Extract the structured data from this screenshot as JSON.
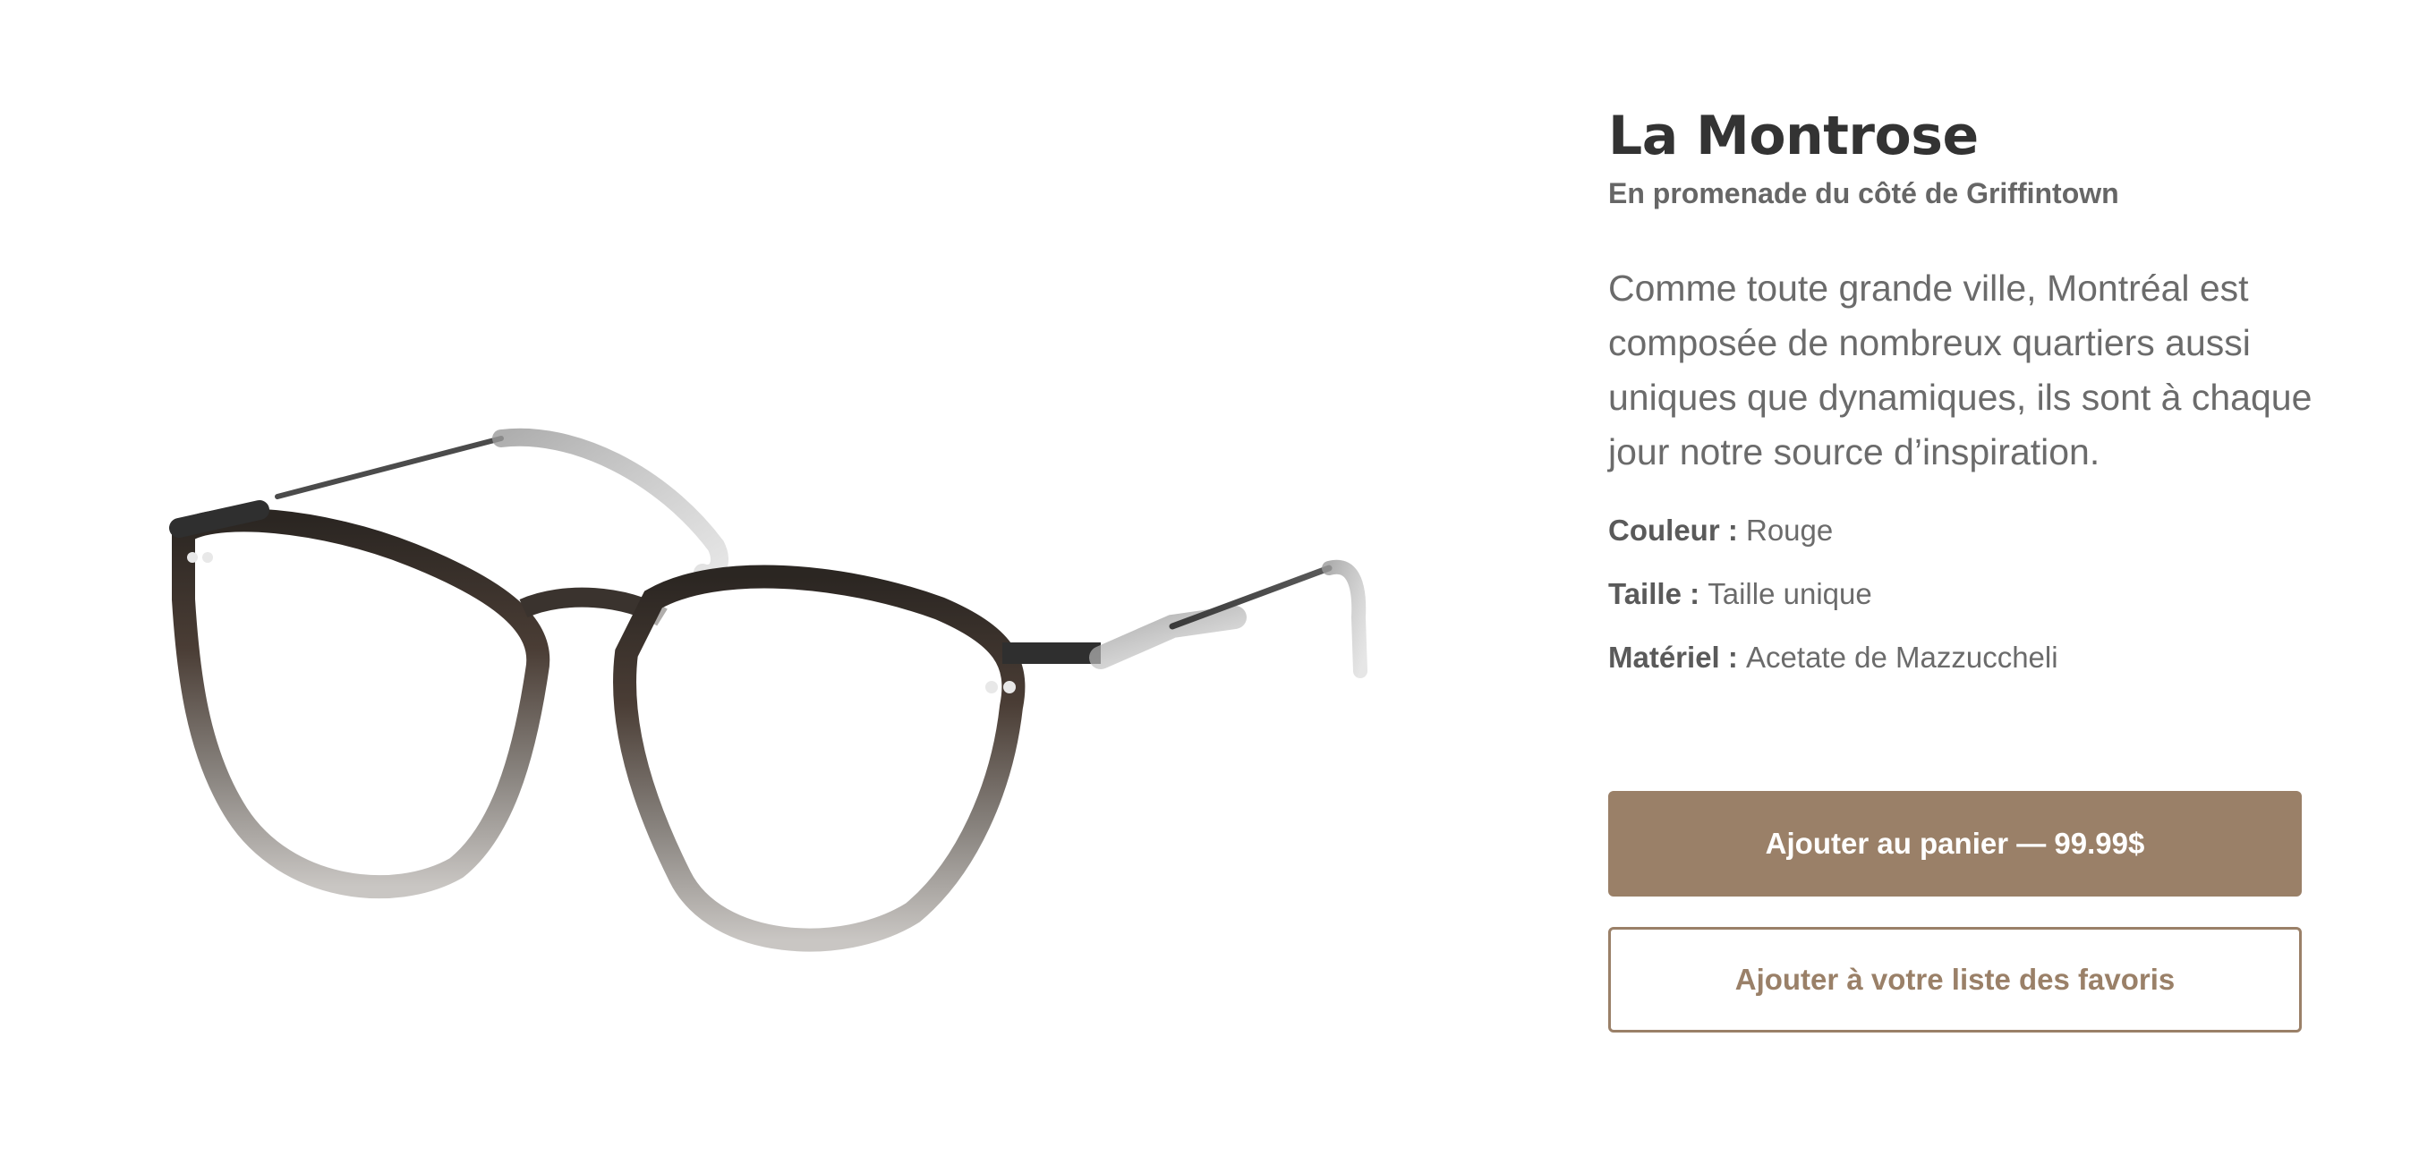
{
  "product": {
    "title": "La Montrose",
    "subtitle": "En promenade du côté de Griffintown",
    "description": "Comme toute grande ville, Montréal est composée de nombreux quartiers aussi uniques que dynamiques, ils sont à chaque jour notre source d’inspiration.",
    "image_alt": "glasses-product-image"
  },
  "specs": [
    {
      "label": "Couleur",
      "sep": " : ",
      "value": "Rouge"
    },
    {
      "label": "Taille",
      "sep": " : ",
      "value": "Taille unique"
    },
    {
      "label": "Matériel",
      "sep": " : ",
      "value": "Acetate de Mazzuccheli"
    }
  ],
  "actions": {
    "add_to_cart": "Ajouter au panier — 99.99$",
    "add_to_favorites": "Ajouter à votre liste des favoris"
  },
  "colors": {
    "accent": "#9a8068",
    "title": "#333333",
    "body_text": "#6b6b6b"
  }
}
